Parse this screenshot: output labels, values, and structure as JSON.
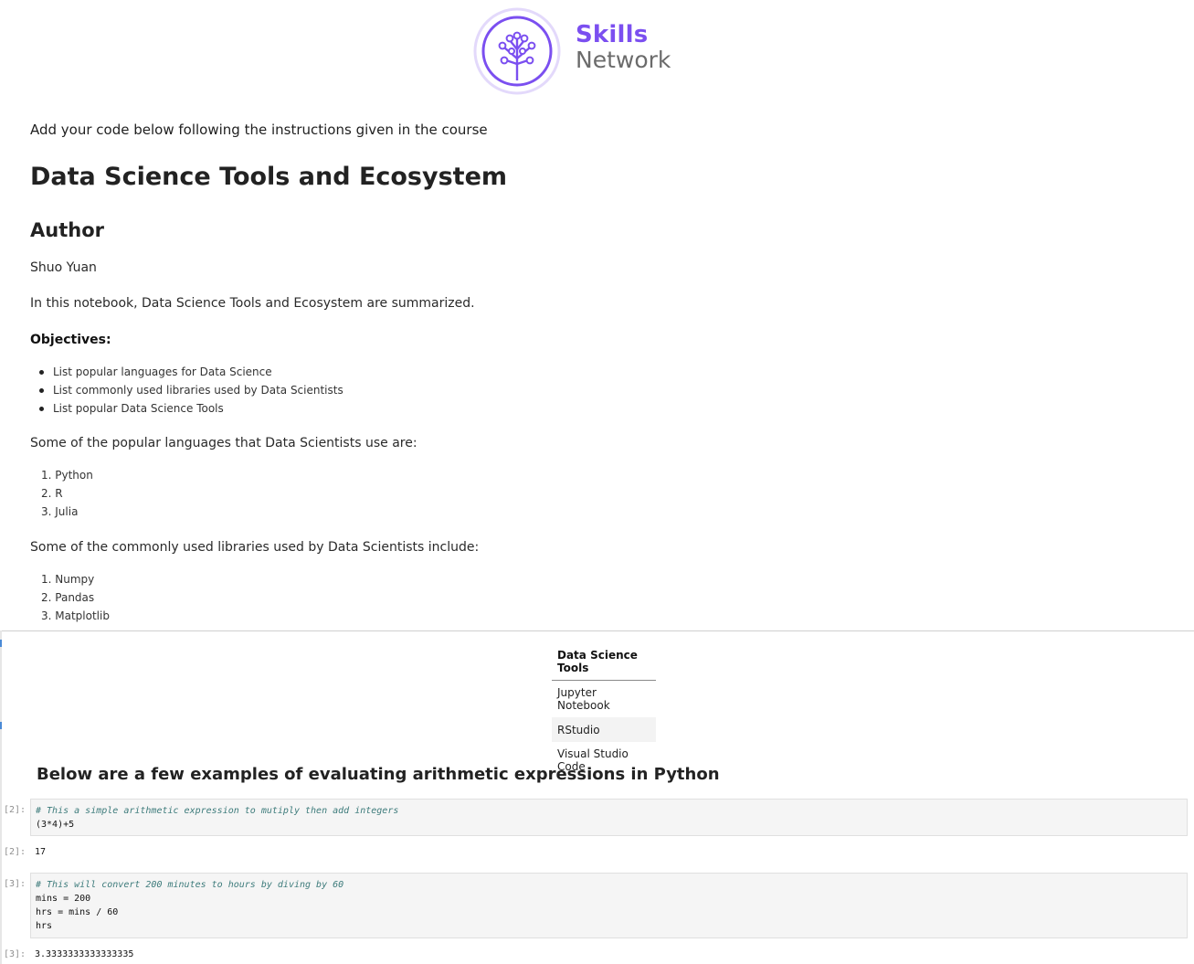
{
  "logo": {
    "skills": "Skills",
    "network": "Network",
    "icon": "tree-network-icon",
    "accent": "#7b4ff0"
  },
  "intro": "Add your code below following the instructions given in the course",
  "title": "Data Science Tools and Ecosystem",
  "author_heading": "Author",
  "author_name": "Shuo Yuan",
  "summary": "In this notebook, Data Science Tools and Ecosystem are summarized.",
  "objectives_heading": "Objectives:",
  "objectives": [
    "List popular languages for Data Science",
    "List commonly used libraries used by Data Scientists",
    "List popular Data Science Tools"
  ],
  "languages_intro": "Some of the popular languages that Data Scientists use are:",
  "languages": [
    "1. Python",
    "2. R",
    "3. Julia"
  ],
  "libraries_intro": "Some of the commonly used libraries used by Data Scientists include:",
  "libraries": [
    "1. Numpy",
    "2. Pandas",
    "3. Matplotlib"
  ],
  "tools_table": {
    "header": "Data Science Tools",
    "rows": [
      "Jupyter Notebook",
      "RStudio",
      "Visual Studio Code"
    ]
  },
  "arith_heading": "Below are a few examples of evaluating arithmetic expressions in Python",
  "cells": [
    {
      "prompt": "[2]:",
      "comment": "# This a simple arithmetic expression to mutiply then add integers",
      "code_line2": "(3*4)+5",
      "output_prompt": "[2]:",
      "output": "17"
    },
    {
      "prompt": "[3]:",
      "comment": "# This will convert 200 minutes to hours by diving by 60",
      "code_line2": "mins = 200",
      "code_line3": "hrs = mins / 60",
      "code_line4": "hrs",
      "output_prompt": "[3]:",
      "output": "3.3333333333333335"
    }
  ]
}
